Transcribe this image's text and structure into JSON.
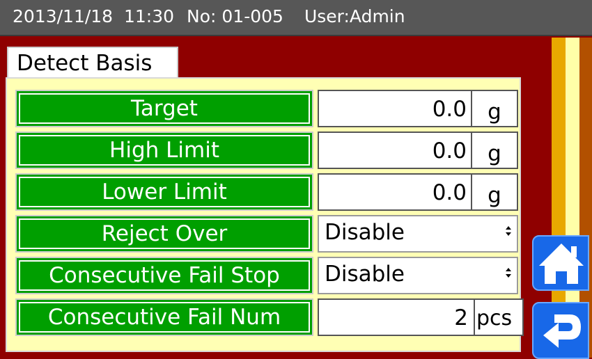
{
  "status_bar": {
    "datetime": "2013/11/18  11:30",
    "number": "No: 01-005",
    "user": "User:Admin"
  },
  "tab": {
    "label": "Detect Basis"
  },
  "fields": {
    "target": {
      "label": "Target",
      "value": "0.0",
      "unit": "g"
    },
    "high_limit": {
      "label": "High Limit",
      "value": "0.0",
      "unit": "g"
    },
    "lower_limit": {
      "label": "Lower Limit",
      "value": "0.0",
      "unit": "g"
    },
    "reject_over": {
      "label": "Reject Over",
      "value": "Disable"
    },
    "consecutive_fail_stop": {
      "label": "Consecutive Fail Stop",
      "value": "Disable"
    },
    "consecutive_fail_num": {
      "label": "Consecutive Fail Num",
      "value": "2",
      "unit": "pcs"
    }
  },
  "select_arrow_glyph": "⬍",
  "nav": {
    "home_icon": "home-icon",
    "back_icon": "return-icon"
  },
  "colors": {
    "background": "#8f0000",
    "label_green": "#009f00",
    "panel": "#ffffb4",
    "button_blue": "#1868e8"
  }
}
